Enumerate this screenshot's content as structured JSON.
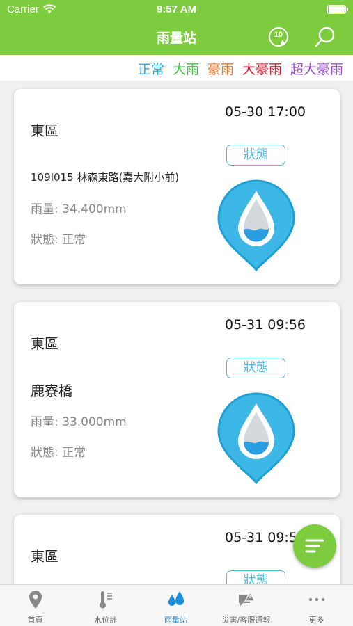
{
  "status_bar": {
    "carrier": "Carrier",
    "time": "9:57 AM"
  },
  "nav": {
    "title": "雨量站",
    "ten_min_label": "10"
  },
  "legend": [
    {
      "label": "正常",
      "color": "#2aa9e0"
    },
    {
      "label": "大雨",
      "color": "#3ec13e"
    },
    {
      "label": "豪雨",
      "color": "#f07a2a"
    },
    {
      "label": "大豪雨",
      "color": "#e0203a"
    },
    {
      "label": "超大豪雨",
      "color": "#9b4fd0"
    }
  ],
  "cards": [
    {
      "district": "東區",
      "timestamp": "05-30 17:00",
      "status_button": "狀態",
      "station": "109I015 林森東路(嘉大附小前)",
      "rainfall": "雨量: 34.400mm",
      "status": "狀態: 正常"
    },
    {
      "district": "東區",
      "timestamp": "05-31 09:56",
      "status_button": "狀態",
      "station": "鹿寮橋",
      "rainfall": "雨量: 33.000mm",
      "status": "狀態: 正常"
    },
    {
      "district": "東區",
      "timestamp": "05-31 09:5",
      "status_button": "狀態"
    }
  ],
  "tabs": [
    {
      "label": "首頁",
      "icon": "location-pin-icon"
    },
    {
      "label": "水位計",
      "icon": "thermometer-gauge-icon"
    },
    {
      "label": "雨量站",
      "icon": "raindrops-icon"
    },
    {
      "label": "災害/客服通報",
      "icon": "report-bubble-icon"
    },
    {
      "label": "更多",
      "icon": "more-dots-icon"
    }
  ],
  "colors": {
    "brand_green": "#7ccc3e",
    "accent_blue": "#4dbde6",
    "active_tab": "#1a8ed8"
  }
}
